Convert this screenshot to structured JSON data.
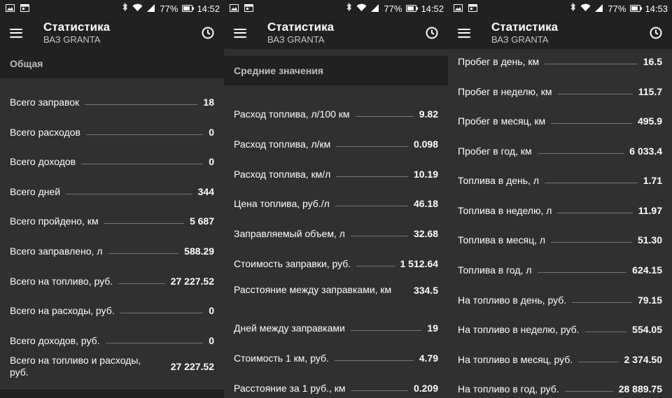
{
  "status": {
    "battery": "77%",
    "times": [
      "14:52",
      "14:52",
      "14:53"
    ]
  },
  "app": {
    "title": "Статистика",
    "subtitle": "ВАЗ GRANTA"
  },
  "panels": [
    {
      "section": "Общая",
      "rows": [
        {
          "label": "Всего заправок",
          "value": "18"
        },
        {
          "label": "Всего расходов",
          "value": "0"
        },
        {
          "label": "Всего доходов",
          "value": "0"
        },
        {
          "label": "Всего дней",
          "value": "344"
        },
        {
          "label": "Всего пройдено, км",
          "value": "5 687"
        },
        {
          "label": "Всего заправлено, л",
          "value": "588.29"
        },
        {
          "label": "Всего на топливо, руб.",
          "value": "27 227.52"
        },
        {
          "label": "Всего на расходы, руб.",
          "value": "0"
        },
        {
          "label": "Всего доходов, руб.",
          "value": "0"
        },
        {
          "label": "Всего на топливо и расходы, руб.",
          "value": "27 227.52"
        }
      ]
    },
    {
      "section": "Средние значения",
      "rows": [
        {
          "label": "Расход топлива, л/100 км",
          "value": "9.82"
        },
        {
          "label": "Расход топлива, л/км",
          "value": "0.098"
        },
        {
          "label": "Расход топлива, км/л",
          "value": "10.19"
        },
        {
          "label": "Цена топлива, руб./л",
          "value": "46.18"
        },
        {
          "label": "Заправляемый объем, л",
          "value": "32.68"
        },
        {
          "label": "Стоимость заправки, руб.",
          "value": "1 512.64"
        },
        {
          "label": "Расстояние между заправками, км",
          "value": "334.5"
        },
        {
          "label": "Дней между заправками",
          "value": "19"
        },
        {
          "label": "Стоимость 1 км, руб.",
          "value": "4.79"
        },
        {
          "label": "Расстояние за 1 руб., км",
          "value": "0.209"
        }
      ]
    },
    {
      "section": "",
      "rows": [
        {
          "label": "Пробег в день, км",
          "value": "16.5"
        },
        {
          "label": "Пробег в неделю, км",
          "value": "115.7"
        },
        {
          "label": "Пробег в месяц, км",
          "value": "495.9"
        },
        {
          "label": "Пробег в год, км",
          "value": "6 033.4"
        },
        {
          "label": "Топлива в день, л",
          "value": "1.71"
        },
        {
          "label": "Топлива в неделю, л",
          "value": "11.97"
        },
        {
          "label": "Топлива в месяц, л",
          "value": "51.30"
        },
        {
          "label": "Топлива в год, л",
          "value": "624.15"
        },
        {
          "label": "На топливо в день, руб.",
          "value": "79.15"
        },
        {
          "label": "На топливо в неделю, руб.",
          "value": "554.05"
        },
        {
          "label": "На топливо в месяц, руб.",
          "value": "2 374.50"
        },
        {
          "label": "На топливо в год, руб.",
          "value": "28 889.75"
        }
      ]
    }
  ]
}
